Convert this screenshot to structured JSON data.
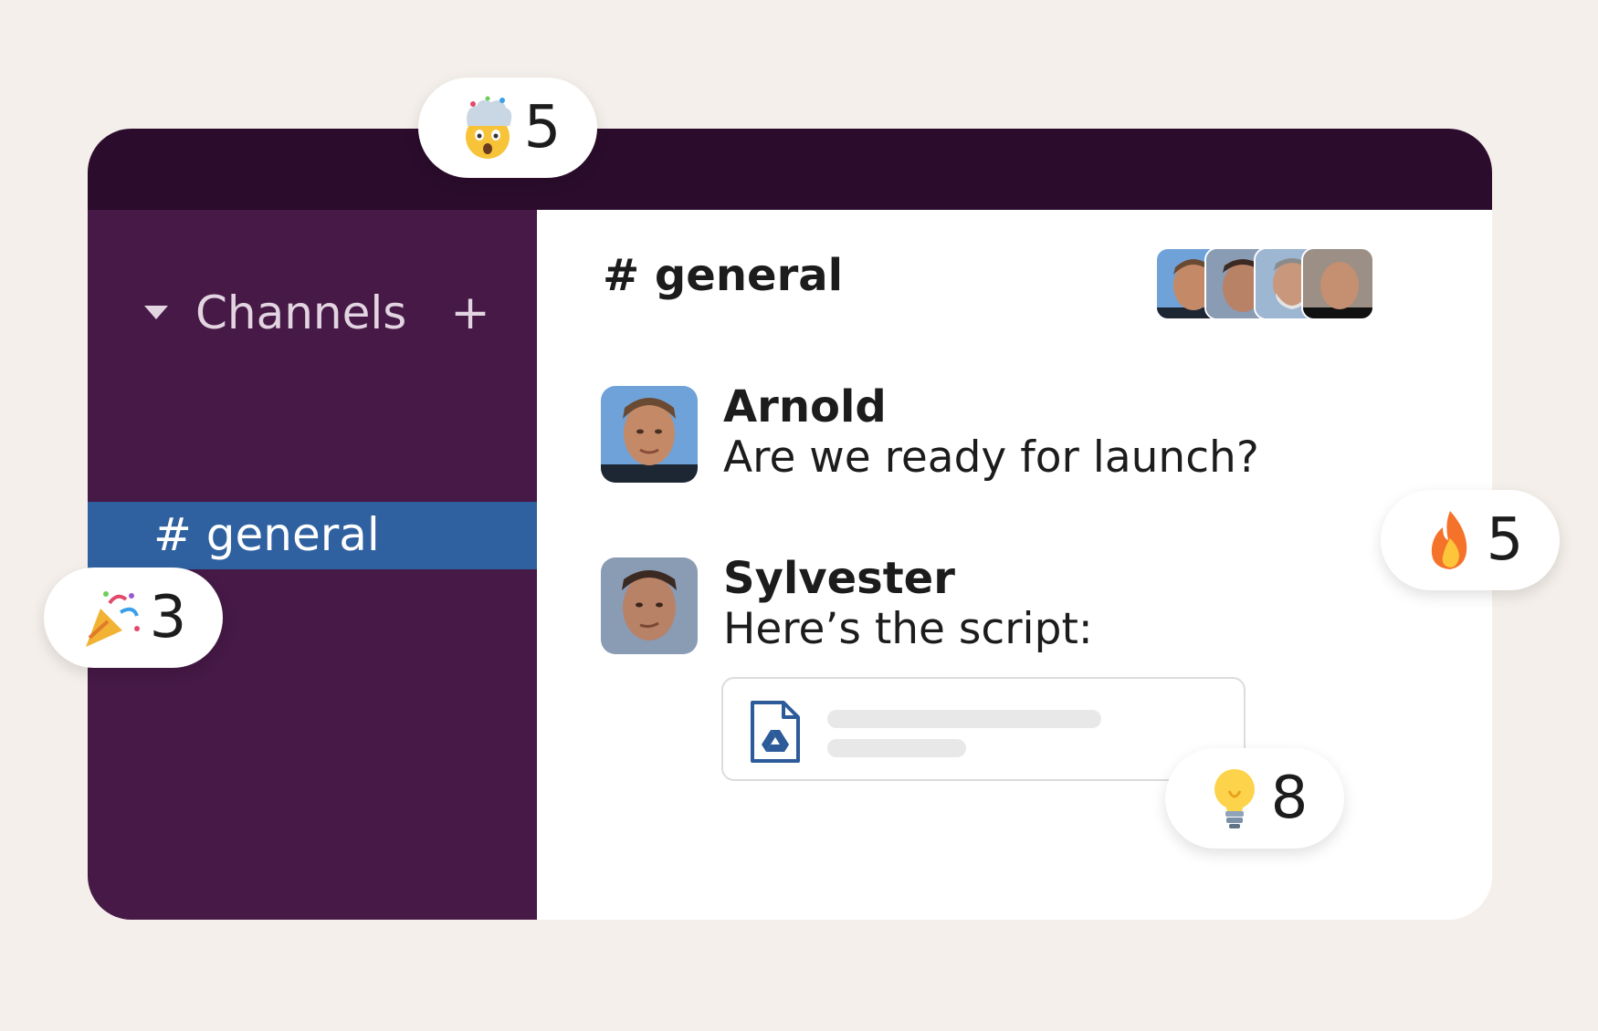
{
  "colors": {
    "page_background": "#f4efea",
    "topbar": "#2b0c2c",
    "sidebar": "#461946",
    "selected_channel": "#2f61a1",
    "sidebar_text": "#e2d4e1"
  },
  "sidebar": {
    "section_label": "Channels",
    "add_icon": "plus-icon",
    "collapse_icon": "caret-down-icon",
    "channels": [
      {
        "label": "# general",
        "selected": true
      }
    ]
  },
  "header": {
    "channel_title": "# general",
    "member_avatars": [
      "member-avatar-1",
      "member-avatar-2",
      "member-avatar-3",
      "member-avatar-4"
    ]
  },
  "messages": [
    {
      "author": "Arnold",
      "text": "Are we ready for launch?"
    },
    {
      "author": "Sylvester",
      "text": "Here’s the script:",
      "attachment": {
        "icon": "google-drive-file-icon"
      }
    }
  ],
  "reactions": [
    {
      "emoji": "exploding-head-emoji",
      "count": "5"
    },
    {
      "emoji": "party-popper-emoji",
      "count": "3"
    },
    {
      "emoji": "fire-emoji",
      "count": "5"
    },
    {
      "emoji": "light-bulb-emoji",
      "count": "8"
    }
  ]
}
